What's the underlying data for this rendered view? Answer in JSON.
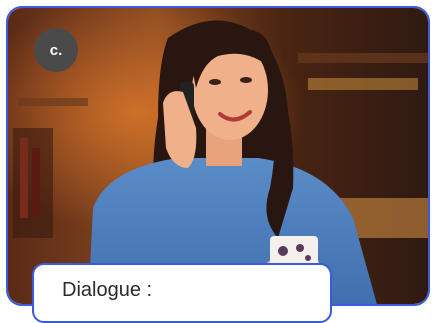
{
  "card": {
    "badge_label": "c.",
    "accent_color": "#3b5bdb",
    "photo_description_icon": "person-on-phone-photo"
  },
  "dialogue": {
    "label": "Dialogue :"
  }
}
